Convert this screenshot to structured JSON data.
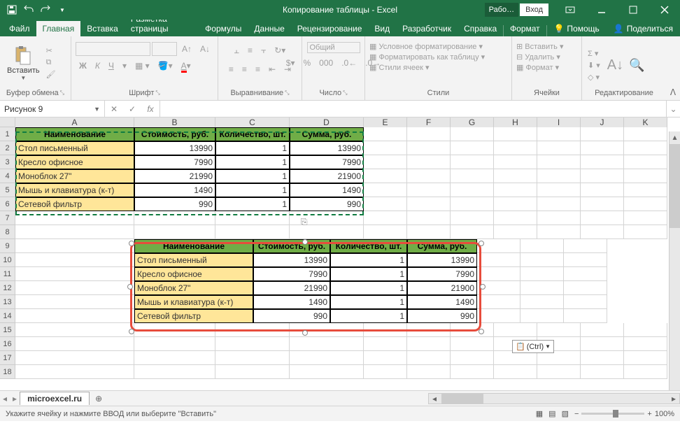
{
  "title": "Копирование таблицы  -  Excel",
  "account": {
    "badge": "Рабо…",
    "login": "Вход"
  },
  "tabs": [
    "Файл",
    "Главная",
    "Вставка",
    "Разметка страницы",
    "Формулы",
    "Данные",
    "Рецензирование",
    "Вид",
    "Разработчик",
    "Справка",
    "Формат"
  ],
  "active_tab": 1,
  "tell_me": "Помощь",
  "share": "Поделиться",
  "ribbon": {
    "clipboard": {
      "paste": "Вставить",
      "label": "Буфер обмена"
    },
    "font": {
      "label": "Шрифт",
      "bold": "Ж",
      "italic": "К",
      "underline": "Ч"
    },
    "align": {
      "label": "Выравнивание"
    },
    "number": {
      "label": "Число",
      "format": "Общий"
    },
    "styles": {
      "label": "Стили",
      "cond": "Условное форматирование",
      "table": "Форматировать как таблицу",
      "cell": "Стили ячеек"
    },
    "cells": {
      "label": "Ячейки",
      "insert": "Вставить",
      "delete": "Удалить",
      "format": "Формат"
    },
    "editing": {
      "label": "Редактирование"
    }
  },
  "namebox": "Рисунок 9",
  "columns": [
    "A",
    "B",
    "C",
    "D",
    "E",
    "F",
    "G",
    "H",
    "I",
    "J",
    "K"
  ],
  "table1": {
    "headers": [
      "Наименование",
      "Стоимость, руб.",
      "Количество, шт.",
      "Сумма, руб."
    ],
    "rows": [
      {
        "name": "Стол письменный",
        "cost": "13990",
        "qty": "1",
        "sum": "13990"
      },
      {
        "name": "Кресло офисное",
        "cost": "7990",
        "qty": "1",
        "sum": "7990"
      },
      {
        "name": "Моноблок 27\"",
        "cost": "21990",
        "qty": "1",
        "sum": "21900"
      },
      {
        "name": "Мышь и клавиатура (к-т)",
        "cost": "1490",
        "qty": "1",
        "sum": "1490"
      },
      {
        "name": "Сетевой фильтр",
        "cost": "990",
        "qty": "1",
        "sum": "990"
      }
    ]
  },
  "paste_options": "(Ctrl)",
  "sheet": "microexcel.ru",
  "status_msg": "Укажите ячейку и нажмите ВВОД или выберите \"Вставить\"",
  "zoom": "100%"
}
